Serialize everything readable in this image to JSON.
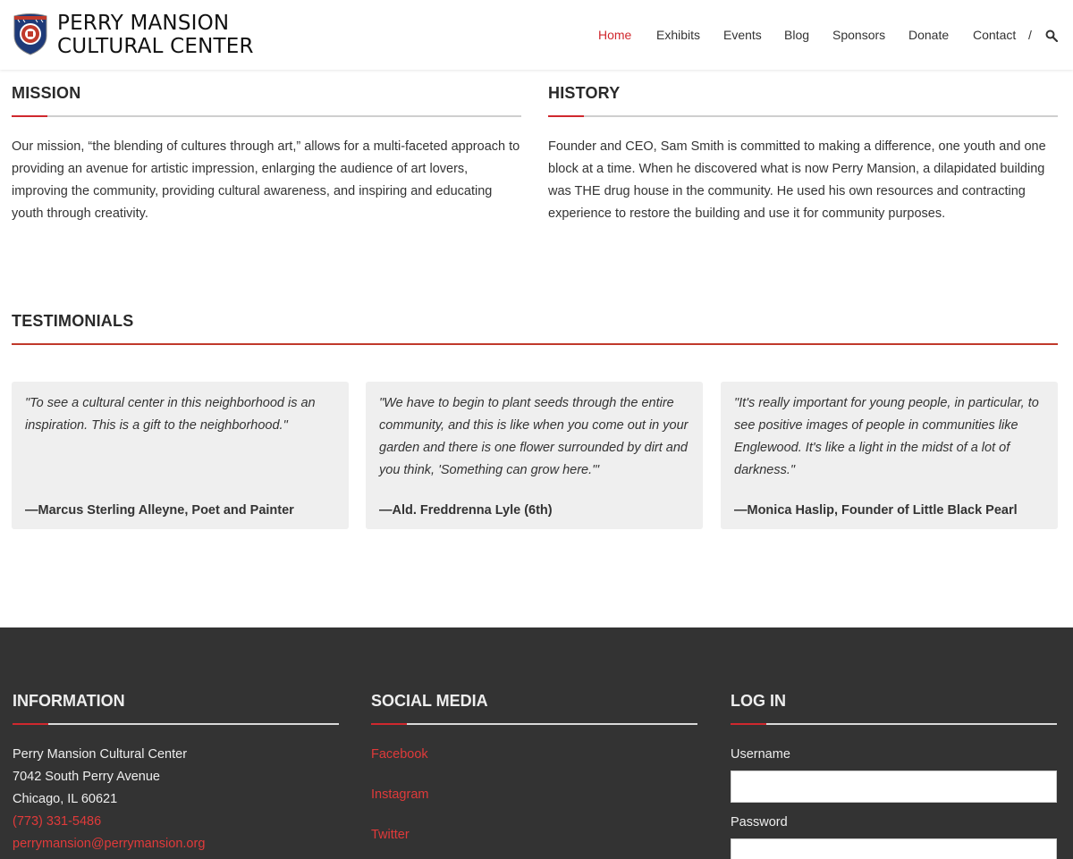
{
  "header": {
    "title_line1": "PERRY MANSION",
    "title_line2": "CULTURAL CENTER",
    "nav": {
      "home": "Home",
      "exhibits": "Exhibits",
      "events": "Events",
      "blog": "Blog",
      "sponsors": "Sponsors",
      "donate": "Donate",
      "contact": "Contact",
      "separator": "/"
    },
    "search_icon": "search-icon",
    "accent_color": "#d0282e"
  },
  "mission": {
    "title": "MISSION",
    "text": "Our mission, “the blending of cultures through art,” allows for a multi-faceted approach to providing an avenue for artistic impression, enlarging the audience of art lovers, improving the community, providing cultural awareness, and inspiring and educating youth through creativity."
  },
  "history": {
    "title": "HISTORY",
    "text": "Founder and CEO, Sam Smith is committed to making a difference, one youth and one block at a time. When he discovered what is now Perry Mansion, a dilapidated building was THE drug house in the community. He used his own resources and contracting experience to restore the building and use it for community purposes."
  },
  "testimonials": {
    "title": "TESTIMONIALS",
    "items": [
      {
        "quote": "\"To see a cultural center in this neighborhood is an inspiration. This is a gift to the neighborhood.\"",
        "author": "—Marcus Sterling Alleyne, Poet and Painter"
      },
      {
        "quote": "\"We have to begin to plant seeds through the entire community, and this is like when you come out in your garden and there is one flower surrounded by dirt and you think, 'Something can grow here.'\"",
        "author": "—Ald. Freddrenna Lyle (6th)"
      },
      {
        "quote": "\"It's really important for young people, in particular, to see positive images of people in communities like Englewood. It's like a light in the midst of a lot of darkness.\"",
        "author": "—Monica Haslip, Founder of Little Black Pearl"
      }
    ]
  },
  "footer": {
    "information": {
      "title": "INFORMATION",
      "name": "Perry Mansion Cultural Center",
      "street": "7042 South Perry Avenue",
      "city": "Chicago, IL 60621",
      "phone": "(773) 331-5486",
      "email": "perrymansion@perrymansion.org"
    },
    "social": {
      "title": "SOCIAL MEDIA",
      "facebook": "Facebook",
      "instagram": "Instagram",
      "twitter": "Twitter"
    },
    "login": {
      "title": "LOG IN",
      "username_label": "Username",
      "password_label": "Password"
    },
    "background": "#333333"
  }
}
